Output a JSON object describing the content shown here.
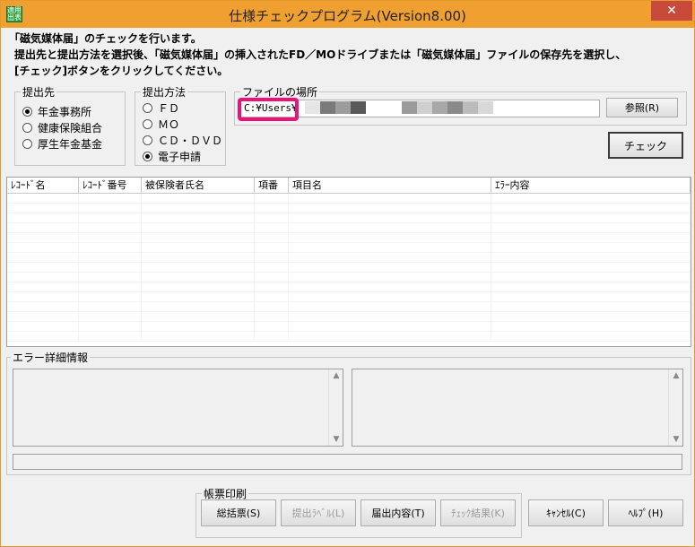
{
  "window": {
    "title": "仕様チェックプログラム(Version8.00)",
    "close_label": "✕",
    "icon_text": "適用 出表",
    "title_bar_color": "#f0a030"
  },
  "intro": {
    "line1": "「磁気媒体届」のチェックを行います。",
    "line2": "提出先と提出方法を選択後、「磁気媒体届」の挿入されたFD／MOドライブまたは「磁気媒体届」ファイルの保存先を選択し、",
    "line3": "[チェック]ボタンをクリックしてください。"
  },
  "submit_to": {
    "label": "提出先",
    "options": [
      "年金事務所",
      "健康保険組合",
      "厚生年金基金"
    ],
    "selected": "年金事務所"
  },
  "method": {
    "label": "提出方法",
    "options": [
      "ＦＤ",
      "ＭＯ",
      "ＣＤ・ＤＶＤ",
      "電子申請"
    ],
    "selected": "電子申請"
  },
  "file_location": {
    "label": "ファイルの場所",
    "path_value": "C:¥Users¥",
    "browse_label": "参照(R)",
    "highlight_color": "#e8147a"
  },
  "check_button_label": "チェック",
  "table": {
    "columns": [
      "ﾚｺｰﾄﾞ名",
      "ﾚｺｰﾄﾞ番号",
      "被保険者氏名",
      "項番",
      "項目名",
      "ｴﾗｰ内容"
    ],
    "rows": []
  },
  "error_detail": {
    "label": "エラー詳細情報"
  },
  "print": {
    "label": "帳票印刷",
    "buttons": [
      {
        "label": "総括票(S)",
        "enabled": true
      },
      {
        "label": "提出ﾗﾍﾞﾙ(L)",
        "enabled": false
      },
      {
        "label": "届出内容(T)",
        "enabled": true
      },
      {
        "label": "ﾁｪｯｸ結果(K)",
        "enabled": false
      }
    ]
  },
  "cancel_label": "ｷｬﾝｾﾙ(C)",
  "help_label": "ﾍﾙﾌﾟ(H)"
}
